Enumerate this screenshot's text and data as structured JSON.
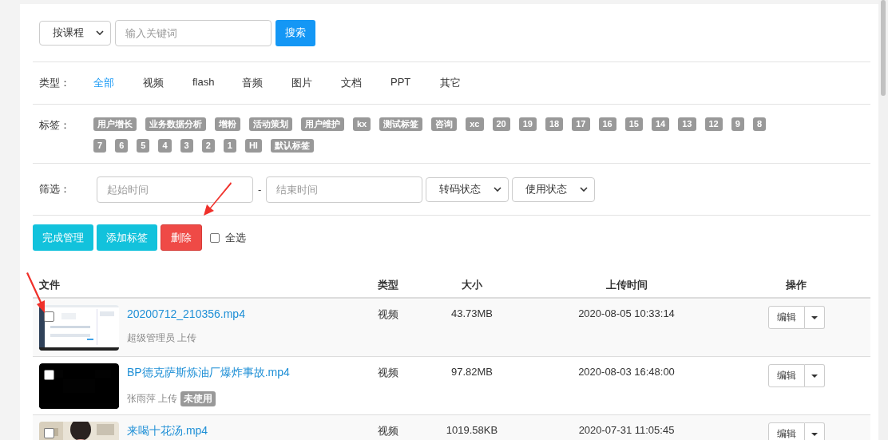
{
  "search": {
    "scope": "按课程",
    "placeholder": "输入关键词",
    "button": "搜索"
  },
  "types": {
    "label": "类型：",
    "items": [
      {
        "label": "全部",
        "selected": true
      },
      {
        "label": "视频",
        "selected": false
      },
      {
        "label": "flash",
        "selected": false
      },
      {
        "label": "音频",
        "selected": false
      },
      {
        "label": "图片",
        "selected": false
      },
      {
        "label": "文档",
        "selected": false
      },
      {
        "label": "PPT",
        "selected": false
      },
      {
        "label": "其它",
        "selected": false
      }
    ]
  },
  "tags": {
    "label": "标签：",
    "items": [
      "用户增长",
      "业务数据分析",
      "增粉",
      "活动策划",
      "用户维护",
      "kx",
      "测试标签",
      "咨询",
      "xc",
      "20",
      "19",
      "18",
      "17",
      "16",
      "15",
      "14",
      "13",
      "12",
      "9",
      "8",
      "7",
      "6",
      "5",
      "4",
      "3",
      "2",
      "1",
      "HI",
      "默认标签"
    ]
  },
  "filter": {
    "label": "筛选：",
    "start_placeholder": "起始时间",
    "separator": "-",
    "end_placeholder": "结束时间",
    "selects": [
      "转码状态",
      "使用状态"
    ]
  },
  "actions": {
    "buttons": [
      {
        "label": "完成管理",
        "kind": "info"
      },
      {
        "label": "添加标签",
        "kind": "info"
      },
      {
        "label": "删除",
        "kind": "danger"
      }
    ],
    "select_all": {
      "label": "全选",
      "checked": false
    }
  },
  "table": {
    "columns": [
      "文件",
      "类型",
      "大小",
      "上传时间",
      "操作"
    ],
    "rows": [
      {
        "name": "20200712_210356.mp4",
        "uploader": "超级管理员 上传",
        "type": "视频",
        "size": "43.73MB",
        "time": "2020-08-05 10:33:14",
        "action": "编辑",
        "checked": false
      },
      {
        "name": "BP德克萨斯炼油厂爆炸事故.mp4",
        "uploader": "张雨萍 上传",
        "badge": "未使用",
        "type": "视频",
        "size": "97.82MB",
        "time": "2020-08-03 16:48:00",
        "action": "编辑",
        "checked": false
      },
      {
        "name": "来喝十花汤.mp4",
        "type": "视频",
        "size": "1019.58KB",
        "time": "2020-07-31 11:05:45",
        "action": "编辑",
        "checked": false
      }
    ]
  }
}
